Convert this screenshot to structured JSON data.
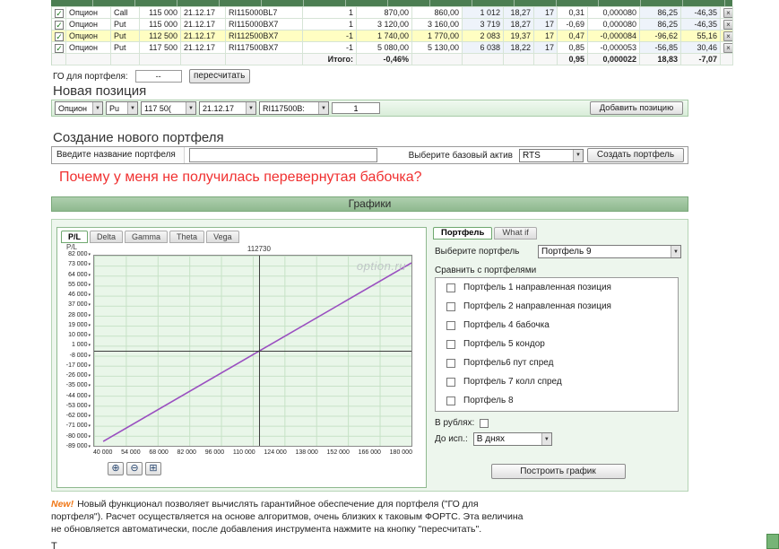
{
  "colors": {
    "accent_green": "#6fa86f",
    "section_bg": "#edf6ed",
    "highlight_row": "#fffec2",
    "line_purple": "#9a4fc0",
    "question_red": "#f03030",
    "new_badge_orange": "#f07818"
  },
  "table": {
    "remove_label": "×",
    "rows": [
      {
        "type": "Опцион",
        "side": "Call",
        "strike": "115 000",
        "expiry": "21.12.17",
        "code": "RI115000BL7",
        "qty": "1",
        "bid": "870,00",
        "ask": "860,00",
        "theo": "1 012",
        "iv": "18,27",
        "days": "17",
        "delta": "0,31",
        "gamma": "0,000080",
        "theta": "86,25",
        "vega": "-46,35",
        "checked": true,
        "highlight": false
      },
      {
        "type": "Опцион",
        "side": "Put",
        "strike": "115 000",
        "expiry": "21.12.17",
        "code": "RI115000BX7",
        "qty": "1",
        "bid": "3 120,00",
        "ask": "3 160,00",
        "theo": "3 719",
        "iv": "18,27",
        "days": "17",
        "delta": "-0,69",
        "gamma": "0,000080",
        "theta": "86,25",
        "vega": "-46,35",
        "checked": true,
        "highlight": false
      },
      {
        "type": "Опцион",
        "side": "Put",
        "strike": "112 500",
        "expiry": "21.12.17",
        "code": "RI112500BX7",
        "qty": "-1",
        "bid": "1 740,00",
        "ask": "1 770,00",
        "theo": "2 083",
        "iv": "19,37",
        "days": "17",
        "delta": "0,47",
        "gamma": "-0,000084",
        "theta": "-96,62",
        "vega": "55,16",
        "checked": true,
        "highlight": true
      },
      {
        "type": "Опцион",
        "side": "Put",
        "strike": "117 500",
        "expiry": "21.12.17",
        "code": "RI117500BX7",
        "qty": "-1",
        "bid": "5 080,00",
        "ask": "5 130,00",
        "theo": "6 038",
        "iv": "18,22",
        "days": "17",
        "delta": "0,85",
        "gamma": "-0,000053",
        "theta": "-56,85",
        "vega": "30,46",
        "checked": true,
        "highlight": false
      }
    ],
    "totals": {
      "label": "Итого:",
      "pct": "-0,46%",
      "delta": "0,95",
      "gamma": "0,000022",
      "theta": "18,83",
      "vega": "-7,07"
    }
  },
  "go": {
    "label": "ГО для портфеля:",
    "value": "--",
    "recalc_button": "пересчитать"
  },
  "new_position": {
    "title": "Новая позиция",
    "type": "Опцион",
    "side": "Pu",
    "strike": "117 50(",
    "expiry": "21.12.17",
    "code": "RI117500B:",
    "qty": "1",
    "add_button": "Добавить позицию"
  },
  "create_portfolio": {
    "title": "Создание нового портфеля",
    "name_label": "Введите название портфеля",
    "name_value": "",
    "asset_label": "Выберите базовый актив",
    "asset_value": "RTS",
    "create_button": "Создать портфель"
  },
  "question": "Почему у меня не получилась перевернутая бабочка?",
  "charts_header": "Графики",
  "chart_panel": {
    "tabs": [
      {
        "label": "P/L",
        "active": true
      },
      {
        "label": "Delta",
        "active": false
      },
      {
        "label": "Gamma",
        "active": false
      },
      {
        "label": "Theta",
        "active": false
      },
      {
        "label": "Vega",
        "active": false
      }
    ],
    "zoom": {
      "in": "⊕",
      "out": "⊖",
      "reset": "⊞"
    }
  },
  "portfolio_panel": {
    "tabs": [
      {
        "label": "Портфель",
        "active": true
      },
      {
        "label": "What if",
        "active": false
      }
    ],
    "select_label": "Выберите портфель",
    "selected_portfolio": "Портфель 9",
    "compare_label": "Сравнить с портфелями",
    "compare_options": [
      "Портфель 1 направленная позиция",
      "Портфель 2 направленная позиция",
      "Портфель 4 бабочка",
      "Портфель 5 кондор",
      "Портфель6 пут спред",
      "Портфель 7 колл спред",
      "Портфель 8"
    ],
    "rub_label": "В рублях:",
    "exp_label": "До исп.:",
    "exp_value": "В днях",
    "build_button": "Построить график"
  },
  "note": {
    "badge": "New!",
    "text": "Новый функционал позволяет вычислять гарантийное обеспечение для портфеля (\"ГО для портфеля\"). Расчет осуществляется на основе алгоритмов, очень близких к таковым ФОРТС. Эта величина не обновляется автоматически, после добавления инструмента нажмите на кнопку \"пересчитать\"."
  },
  "footer_cut": "Т",
  "chart_data": {
    "type": "line",
    "title": "P/L",
    "ylabel": "P/L",
    "xlabel": "",
    "xlim": [
      40000,
      180000
    ],
    "ylim": [
      -89000,
      82000
    ],
    "xticks": [
      "40 000",
      "54 000",
      "68 000",
      "82 000",
      "96 000",
      "110 000",
      "124 000",
      "138 000",
      "152 000",
      "166 000",
      "180 000"
    ],
    "yticks": [
      "82 000",
      "73 000",
      "64 000",
      "55 000",
      "46 000",
      "37 000",
      "28 000",
      "19 000",
      "10 000",
      "1 000",
      "-8 000",
      "-17 000",
      "-26 000",
      "-35 000",
      "-44 000",
      "-53 000",
      "-62 000",
      "-71 000",
      "-80 000",
      "-89 000"
    ],
    "series": [
      {
        "name": "P/L",
        "color": "#9a4fc0",
        "points": [
          [
            44000,
            -85000
          ],
          [
            112730,
            -3900
          ],
          [
            180000,
            75500
          ]
        ]
      }
    ],
    "crosshair": {
      "x": 112730,
      "y": -3900,
      "label": "112730"
    },
    "grid": true,
    "legend": false,
    "watermark": "option.ru"
  }
}
